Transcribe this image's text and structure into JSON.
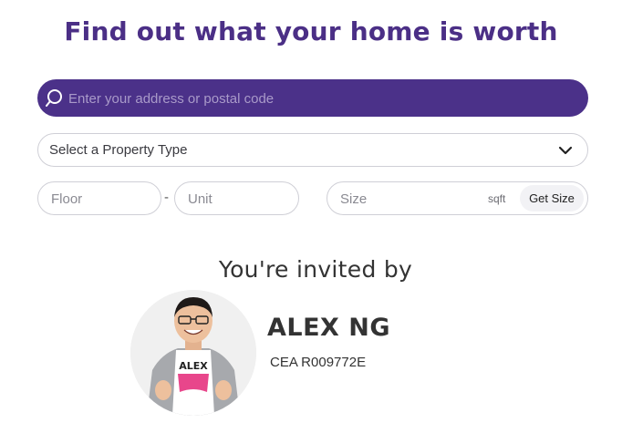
{
  "header": {
    "title": "Find out what your home is worth"
  },
  "search": {
    "placeholder": "Enter your address or postal code",
    "icon": "search-icon"
  },
  "property_type": {
    "selected": "Select a Property Type",
    "icon": "chevron-down-icon"
  },
  "floor": {
    "placeholder": "Floor"
  },
  "separator": "-",
  "unit": {
    "placeholder": "Unit"
  },
  "size": {
    "placeholder": "Size",
    "unit_label": "sqft",
    "button_label": "Get Size"
  },
  "invite": {
    "heading": "You're invited by",
    "agent_name": "ALEX NG",
    "agent_cea": "CEA R009772E",
    "shirt_text": "ALEX"
  },
  "colors": {
    "brand": "#4b2f86",
    "search_bg": "#4b3189",
    "accent_pink": "#e8468b"
  }
}
